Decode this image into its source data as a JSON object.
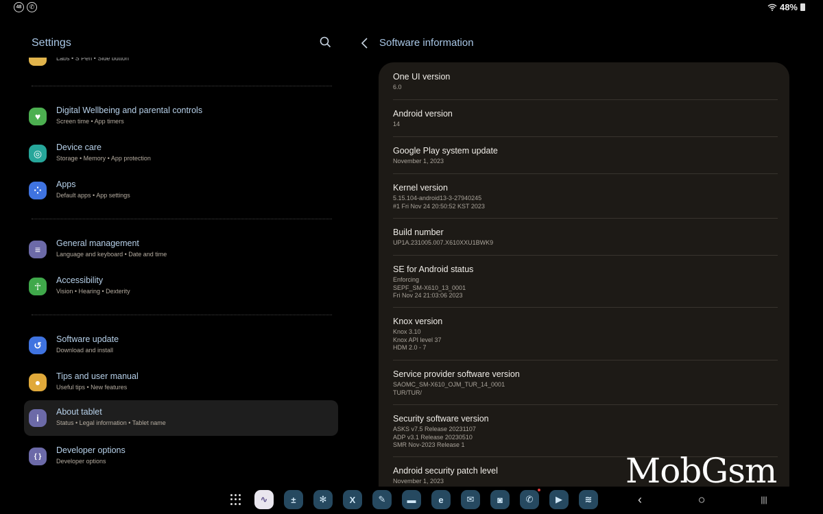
{
  "status_bar": {
    "left_icons": [
      "notification-count-icon",
      "whatsapp-icon"
    ],
    "notification_badge": "48",
    "battery_percent": "48%",
    "battery_level": 0.48
  },
  "settings": {
    "title": "Settings",
    "search_icon": "search-icon",
    "partial_item_sub": "Labs  •  S Pen  •  Side button",
    "items": [
      {
        "title": "Digital Wellbeing and parental controls",
        "sub": "Screen time  •  App timers",
        "icon": "wellbeing-icon",
        "color": "#4caf50",
        "glyph": "♥"
      },
      {
        "title": "Device care",
        "sub": "Storage  •  Memory  •  App protection",
        "icon": "device-care-icon",
        "color": "#26a69a",
        "glyph": "◎"
      },
      {
        "title": "Apps",
        "sub": "Default apps  •  App settings",
        "icon": "apps-icon",
        "color": "#3f73e0",
        "glyph": "⁘"
      },
      {
        "title": "General management",
        "sub": "Language and keyboard  •  Date and time",
        "icon": "general-management-icon",
        "color": "#6c6aa8",
        "glyph": "≡"
      },
      {
        "title": "Accessibility",
        "sub": "Vision  •  Hearing  •  Dexterity",
        "icon": "accessibility-icon",
        "color": "#3fa84a",
        "glyph": "☥"
      },
      {
        "title": "Software update",
        "sub": "Download and install",
        "icon": "software-update-icon",
        "color": "#3f73e0",
        "glyph": "↺"
      },
      {
        "title": "Tips and user manual",
        "sub": "Useful tips  •  New features",
        "icon": "tips-icon",
        "color": "#e0a93a",
        "glyph": "●"
      },
      {
        "title": "About tablet",
        "sub": "Status  •  Legal information  •  Tablet name",
        "icon": "info-icon",
        "color": "#6c6aa8",
        "glyph": "i",
        "selected": true
      },
      {
        "title": "Developer options",
        "sub": "Developer options",
        "icon": "developer-options-icon",
        "color": "#6c6aa8",
        "glyph": "{ }"
      }
    ]
  },
  "software_info": {
    "title": "Software information",
    "rows": [
      {
        "label": "One UI version",
        "values": [
          "6.0"
        ]
      },
      {
        "label": "Android version",
        "values": [
          "14"
        ]
      },
      {
        "label": "Google Play system update",
        "values": [
          "November 1, 2023"
        ]
      },
      {
        "label": "Kernel version",
        "values": [
          "5.15.104-android13-3-27940245",
          "#1 Fri Nov 24 20:50:52 KST 2023"
        ]
      },
      {
        "label": "Build number",
        "values": [
          "UP1A.231005.007.X610XXU1BWK9"
        ]
      },
      {
        "label": "SE for Android status",
        "values": [
          "Enforcing",
          "SEPF_SM-X610_13_0001",
          "Fri Nov 24 21:03:06 2023"
        ]
      },
      {
        "label": "Knox version",
        "values": [
          "Knox 3.10",
          "Knox API level 37",
          "HDM 2.0 - 7"
        ]
      },
      {
        "label": "Service provider software version",
        "values": [
          "SAOMC_SM-X610_OJM_TUR_14_0001",
          "TUR/TUR/"
        ]
      },
      {
        "label": "Security software version",
        "values": [
          "ASKS v7.5  Release 20231107",
          "ADP v3.1 Release 20230510",
          "SMR Nov-2023 Release 1"
        ]
      },
      {
        "label": "Android security patch level",
        "values": [
          "November 1, 2023"
        ]
      }
    ]
  },
  "taskbar": {
    "apps": [
      {
        "name": "app-drawer-icon"
      },
      {
        "name": "notes-app-icon",
        "glyph": "∿"
      },
      {
        "name": "calculator-icon",
        "glyph": "±"
      },
      {
        "name": "bixby-icon",
        "glyph": "✻"
      },
      {
        "name": "excel-icon",
        "glyph": "X"
      },
      {
        "name": "samsung-notes-icon",
        "glyph": "✎"
      },
      {
        "name": "my-files-icon",
        "glyph": "▬"
      },
      {
        "name": "edge-browser-icon",
        "glyph": "e"
      },
      {
        "name": "email-icon",
        "glyph": "✉"
      },
      {
        "name": "camera-icon",
        "glyph": "◙"
      },
      {
        "name": "whatsapp-icon",
        "glyph": "✆",
        "badge": true
      },
      {
        "name": "youtube-icon",
        "glyph": "▶"
      },
      {
        "name": "spotify-icon",
        "glyph": "≋"
      }
    ],
    "nav": [
      "back-icon",
      "home-icon",
      "recents-icon"
    ],
    "nav_glyphs": [
      "‹",
      "○",
      "|||"
    ]
  },
  "watermark": "MobGsm"
}
